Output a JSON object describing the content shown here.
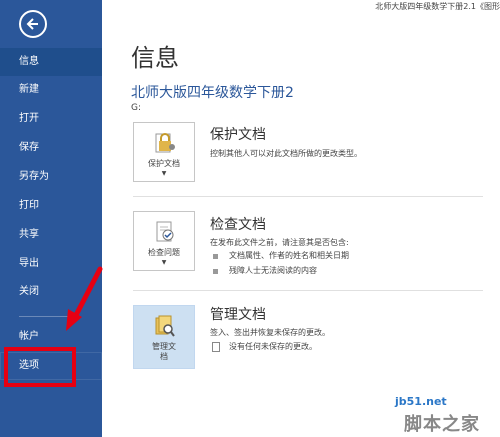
{
  "window": {
    "title": "北师大版四年级数学下册2.1《图形"
  },
  "sidebar": {
    "items": [
      {
        "label": "信息"
      },
      {
        "label": "新建"
      },
      {
        "label": "打开"
      },
      {
        "label": "保存"
      },
      {
        "label": "另存为"
      },
      {
        "label": "打印"
      },
      {
        "label": "共享"
      },
      {
        "label": "导出"
      },
      {
        "label": "关闭"
      },
      {
        "label": "帐户"
      },
      {
        "label": "选项"
      }
    ]
  },
  "main": {
    "heading": "信息",
    "doc_title": "北师大版四年级数学下册2",
    "doc_path": "G:",
    "sections": [
      {
        "tile_label": "保护文档",
        "title": "保护文档",
        "desc": "控制其他人可以对此文档所做的更改类型。"
      },
      {
        "tile_label": "检查问题",
        "title": "检查文档",
        "desc": "在发布此文件之前，请注意其是否包含:",
        "bullets": [
          "文档属性、作者的姓名和相关日期",
          "残障人士无法阅读的内容"
        ]
      },
      {
        "tile_label": "管理文档",
        "tile_label_line1": "管理文",
        "tile_label_line2": "档",
        "title": "管理文档",
        "desc": "签入、签出并恢复未保存的更改。",
        "note": "没有任何未保存的更改。"
      }
    ]
  },
  "watermark": {
    "url": "jb51.net",
    "text": "脚本之家"
  },
  "colors": {
    "sidebar": "#2b579a",
    "accent": "#2b579a",
    "annotation": "#e60012"
  }
}
